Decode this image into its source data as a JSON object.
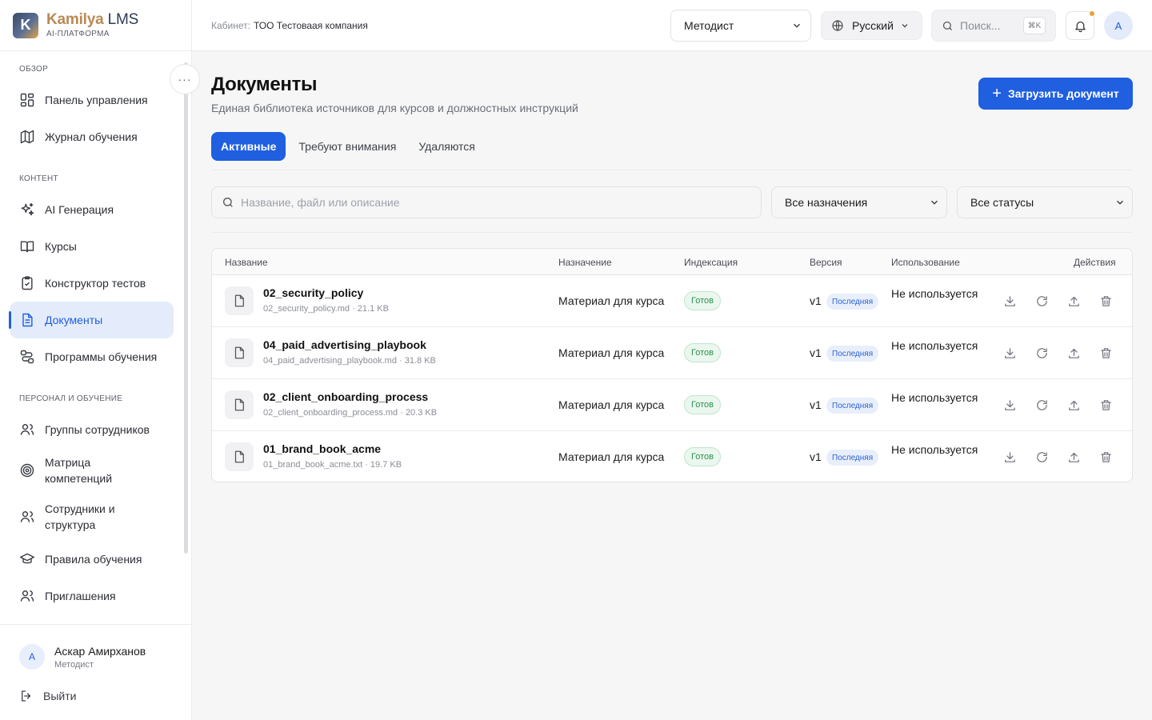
{
  "brand": {
    "logo_letter": "K",
    "name_main": "Kamilya",
    "name_suffix": "LMS",
    "subtitle": "AI-ПЛАТФОРМА"
  },
  "sidebar": {
    "more_label": "···",
    "sections": [
      {
        "label": "Обзор"
      },
      {
        "label": "Контент"
      },
      {
        "label": "Персонал и обучение"
      }
    ],
    "items": [
      {
        "label": "Панель управления",
        "icon": "dashboard-icon"
      },
      {
        "label": "Журнал обучения",
        "icon": "map-icon"
      },
      {
        "label": "AI Генерация",
        "icon": "sparkles-icon"
      },
      {
        "label": "Курсы",
        "icon": "book-icon"
      },
      {
        "label": "Конструктор тестов",
        "icon": "clipboard-check-icon"
      },
      {
        "label": "Документы",
        "icon": "document-icon",
        "active": true
      },
      {
        "label": "Программы обучения",
        "icon": "route-icon"
      },
      {
        "label": "Группы сотрудников",
        "icon": "users-icon"
      },
      {
        "label": "Матрица компетенций",
        "icon": "target-icon"
      },
      {
        "label": "Сотрудники и структура",
        "icon": "users-icon"
      },
      {
        "label": "Правила обучения",
        "icon": "graduation-cap-icon"
      },
      {
        "label": "Приглашения",
        "icon": "users-icon"
      }
    ],
    "user": {
      "initial": "А",
      "name": "Аскар Амирханов",
      "role": "Методист"
    },
    "logout_label": "Выйти"
  },
  "header": {
    "cabinet_label": "Кабинет:",
    "cabinet_value": "ТОО Тестоваая компания",
    "role_value": "Методист",
    "language": "Русский",
    "search_placeholder": "Поиск...",
    "search_shortcut": "⌘K",
    "avatar_initial": "А"
  },
  "page": {
    "title": "Документы",
    "subtitle": "Единая библиотека источников для курсов и должностных инструкций",
    "upload_label": "Загрузить документ",
    "tabs": [
      {
        "label": "Активные",
        "active": true
      },
      {
        "label": "Требуют внимания"
      },
      {
        "label": "Удаляются"
      }
    ],
    "filters": {
      "search_placeholder": "Название, файл или описание",
      "purpose_value": "Все назначения",
      "status_value": "Все статусы"
    }
  },
  "table": {
    "columns": [
      "Название",
      "Назначение",
      "Индексация",
      "Версия",
      "Использование",
      "Действия"
    ],
    "rows": [
      {
        "name": "02_security_policy",
        "meta": "02_security_policy.md · 21.1 KB",
        "purpose": "Материал для курса",
        "indexing": "Готов",
        "version": "v1",
        "version_badge": "Последняя",
        "usage": "Не используется"
      },
      {
        "name": "04_paid_advertising_playbook",
        "meta": "04_paid_advertising_playbook.md · 31.8 KB",
        "purpose": "Материал для курса",
        "indexing": "Готов",
        "version": "v1",
        "version_badge": "Последняя",
        "usage": "Не используется"
      },
      {
        "name": "02_client_onboarding_process",
        "meta": "02_client_onboarding_process.md · 20.3 KB",
        "purpose": "Материал для курса",
        "indexing": "Готов",
        "version": "v1",
        "version_badge": "Последняя",
        "usage": "Не используется"
      },
      {
        "name": "01_brand_book_acme",
        "meta": "01_brand_book_acme.txt · 19.7 KB",
        "purpose": "Материал для курса",
        "indexing": "Готов",
        "version": "v1",
        "version_badge": "Последняя",
        "usage": "Не используется"
      }
    ],
    "row_actions": [
      "download-icon",
      "refresh-icon",
      "upload-icon",
      "trash-icon"
    ]
  },
  "colors": {
    "accent": "#1f5fe0",
    "ready_text": "#27934a",
    "ready_bg": "#eaf7ee",
    "notification_dot": "#e6a23c"
  }
}
